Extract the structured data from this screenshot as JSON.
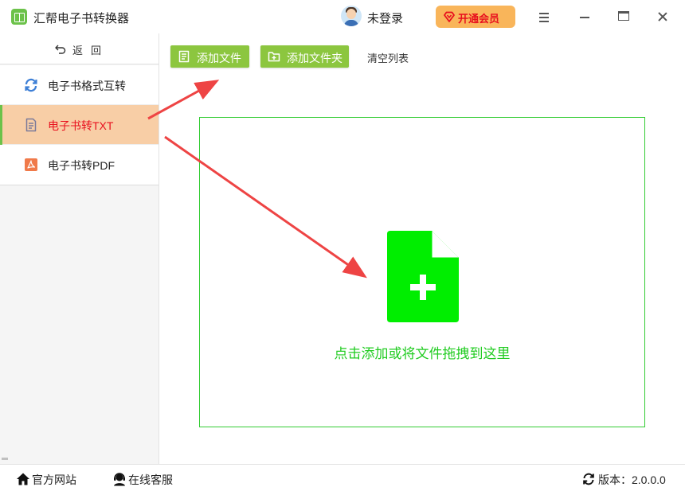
{
  "app": {
    "title": "汇帮电子书转换器",
    "accent_color": "#8cc63f",
    "logo_icon": "book-icon"
  },
  "user": {
    "name": "未登录",
    "avatar_icon": "user-avatar-icon"
  },
  "vip": {
    "label": "开通会员",
    "icon": "diamond-icon",
    "background_color": "#f9b55a",
    "text_color": "#e8101e"
  },
  "window_controls": [
    "menu-icon",
    "minimize-icon",
    "maximize-icon",
    "close-icon"
  ],
  "sidebar": {
    "back_label": "返回",
    "back_icon": "back-arrow-icon",
    "items": [
      {
        "label": "电子书格式互转",
        "icon": "refresh-icon",
        "active": false
      },
      {
        "label": "电子书转TXT",
        "icon": "document-icon",
        "active": true
      },
      {
        "label": "电子书转PDF",
        "icon": "pdf-icon",
        "active": false
      }
    ],
    "active_background": "#f8cea6",
    "active_text_color": "#e8101e"
  },
  "toolbar": {
    "add_file_label": "添加文件",
    "add_folder_label": "添加文件夹",
    "clear_list_label": "清空列表"
  },
  "drop_zone": {
    "text": "点击添加或将文件拖拽到这里",
    "icon": "add-file-icon",
    "color": "#00ee00"
  },
  "footer": {
    "official_site_label": "官方网站",
    "online_service_label": "在线客服",
    "version_label": "版本：2.0.0.0"
  }
}
